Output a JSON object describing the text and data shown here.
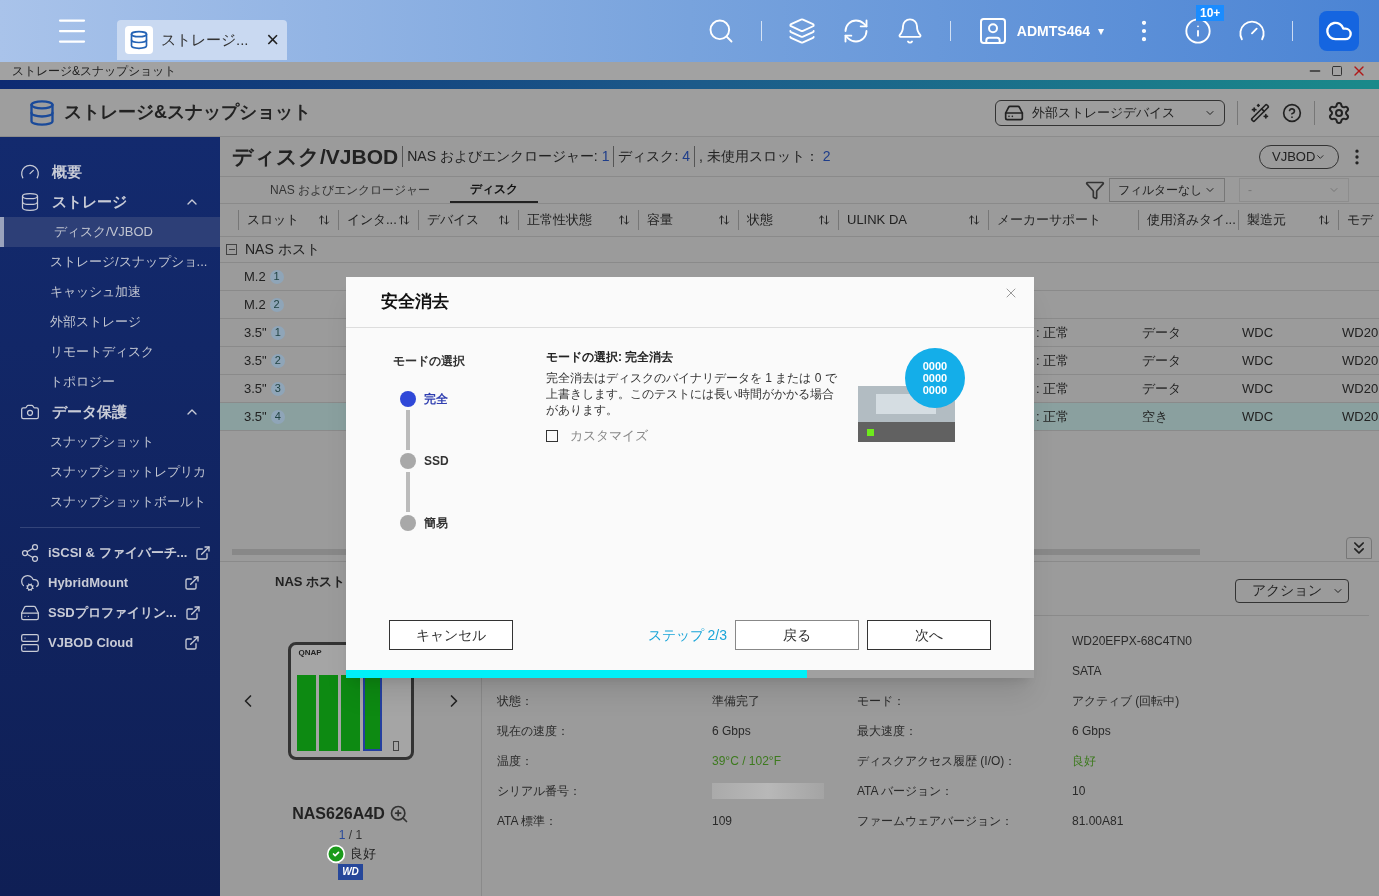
{
  "taskbar": {
    "app_tab": {
      "label": "ストレージ...",
      "close": "×"
    },
    "user": {
      "name": "ADMTS464",
      "caret": "▾"
    },
    "notification_badge": "10+"
  },
  "window": {
    "title": "ストレージ&スナップショット",
    "app_title": "ストレージ&スナップショット",
    "device_menu": "外部ストレージデバイス"
  },
  "sidebar": {
    "items": [
      {
        "kind": "section",
        "label": "概要"
      },
      {
        "kind": "section",
        "label": "ストレージ",
        "expanded": true
      },
      {
        "kind": "item",
        "label": "ディスク/VJBOD",
        "selected": true
      },
      {
        "kind": "item",
        "label": "ストレージ/スナップショ...",
        "selected": false
      },
      {
        "kind": "item",
        "label": "キャッシュ加速",
        "selected": false
      },
      {
        "kind": "item",
        "label": "外部ストレージ",
        "selected": false
      },
      {
        "kind": "item",
        "label": "リモートディスク",
        "selected": false
      },
      {
        "kind": "item",
        "label": "トポロジー",
        "selected": false
      },
      {
        "kind": "section",
        "label": "データ保護",
        "expanded": true
      },
      {
        "kind": "item",
        "label": "スナップショット",
        "selected": false
      },
      {
        "kind": "item",
        "label": "スナップショットレプリカ",
        "selected": false
      },
      {
        "kind": "item",
        "label": "スナップショットボールト",
        "selected": false
      },
      {
        "kind": "divider"
      },
      {
        "kind": "external",
        "label": "iSCSI & ファイバーチ..."
      },
      {
        "kind": "external",
        "label": "HybridMount"
      },
      {
        "kind": "external",
        "label": "SSDプロファイリン..."
      },
      {
        "kind": "external",
        "label": "VJBOD Cloud"
      }
    ]
  },
  "page": {
    "title": "ディスク/VJBOD",
    "summary": [
      {
        "label": "NAS およびエンクロージャー:",
        "value": "1"
      },
      {
        "label": "ディスク:",
        "value": "4"
      },
      {
        "label": ", 未使用スロット：",
        "value": "2"
      }
    ],
    "scope_menu": "VJBOD",
    "tabs": [
      {
        "label": "NAS およびエンクロージャー",
        "selected": false
      },
      {
        "label": "ディスク",
        "selected": true
      }
    ],
    "filter": {
      "value": "フィルターなし",
      "second_value": "-"
    }
  },
  "table": {
    "columns": [
      {
        "label": "スロット",
        "sortable": true
      },
      {
        "label": "インタ...",
        "sortable": true
      },
      {
        "label": "デバイス",
        "sortable": true
      },
      {
        "label": "正常性状態",
        "sortable": true
      },
      {
        "label": "容量",
        "sortable": true
      },
      {
        "label": "状態",
        "sortable": true
      },
      {
        "label": "ULINK DA",
        "sortable": true
      },
      {
        "label": "メーカーサポート",
        "sortable": false
      },
      {
        "label": "使用済みタイ..."
      },
      {
        "label": "製造元",
        "sortable": true
      },
      {
        "label": "モデ"
      }
    ],
    "group": {
      "label": "NAS ホスト",
      "expanded": true
    },
    "rows": [
      {
        "slot": "M.2",
        "number": "1",
        "selected": false
      },
      {
        "slot": "M.2",
        "number": "2",
        "selected": false
      },
      {
        "slot": "3.5\"",
        "number": "1",
        "support": ": 正常",
        "used_type": "データ",
        "maker": "WDC",
        "model": "WD20",
        "selected": false
      },
      {
        "slot": "3.5\"",
        "number": "2",
        "support": ": 正常",
        "used_type": "データ",
        "maker": "WDC",
        "model": "WD20",
        "selected": false
      },
      {
        "slot": "3.5\"",
        "number": "3",
        "support": ": 正常",
        "used_type": "データ",
        "maker": "WDC",
        "model": "WD20",
        "selected": false
      },
      {
        "slot": "3.5\"",
        "number": "4",
        "support": ": 正常",
        "used_type": "空き",
        "maker": "WDC",
        "model": "WD20",
        "selected": true
      }
    ]
  },
  "details": {
    "heading": "NAS ホスト",
    "action": "アクション",
    "device": {
      "brand": "QNAP",
      "name": "NAS626A4D",
      "page": "1",
      "pages": "/ 1",
      "status": "良好",
      "logo": "WD"
    },
    "rows": [
      {
        "value2": "WD20EFPX-68C4TN0"
      },
      {
        "value2": "SATA"
      },
      {
        "label1": "状態：",
        "value1": "準備完了",
        "label2": "モード：",
        "value2": "アクティブ (回転中)"
      },
      {
        "label1": "現在の速度：",
        "value1": "6 Gbps",
        "label2": "最大速度：",
        "value2": "6 Gbps"
      },
      {
        "label1": "温度：",
        "value1": "39°C / 102°F",
        "value1_good": true,
        "label2": "ディスクアクセス履歴 (I/O)：",
        "value2": "良好",
        "value2_good": true
      },
      {
        "label1": "シリアル番号：",
        "value1_redacted": true,
        "label2": "ATA バージョン：",
        "value2": "10"
      },
      {
        "label1": "ATA 標準：",
        "value1": "109",
        "label2": "ファームウェアバージョン：",
        "value2": "81.00A81"
      }
    ]
  },
  "dialog": {
    "title": "安全消去",
    "steps_heading": "モードの選択",
    "steps": [
      {
        "label": "完全",
        "selected": true
      },
      {
        "label": "SSD",
        "selected": false
      },
      {
        "label": "簡易",
        "selected": false
      }
    ],
    "mode_heading": "モードの選択: 完全消去",
    "description": "完全消去はディスクのバイナリデータを 1 または 0 で上書きします。このテストには長い時間がかかる場合があります。",
    "customize": {
      "label": "カスタマイズ",
      "checked": false
    },
    "disk_bits": [
      "0000",
      "0000",
      "0000"
    ],
    "cancel": "キャンセル",
    "step": "ステップ 2/3",
    "back": "戻る",
    "next": "次へ",
    "progress": {
      "level": 0.67
    }
  }
}
